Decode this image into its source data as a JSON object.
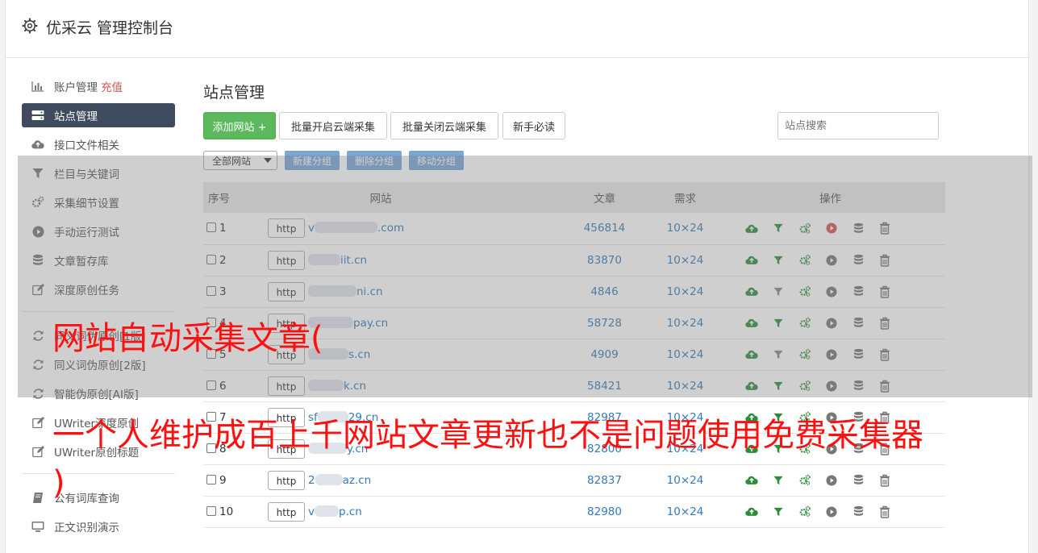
{
  "header": {
    "title": "优采云 管理控制台"
  },
  "sidebar": {
    "items": [
      {
        "label": "账户管理",
        "badge": "充值",
        "icon": "bar-chart-icon"
      },
      {
        "label": "站点管理",
        "icon": "server-icon",
        "active": true
      },
      {
        "label": "接口文件相关",
        "icon": "cloud-upload-icon"
      },
      {
        "label": "栏目与关键词",
        "icon": "filter-icon"
      },
      {
        "label": "采集细节设置",
        "icon": "cogs-icon"
      },
      {
        "label": "手动运行测试",
        "icon": "play-icon"
      },
      {
        "label": "文章暂存库",
        "icon": "database-icon"
      },
      {
        "label": "深度原创任务",
        "icon": "edit-icon"
      }
    ],
    "items2": [
      {
        "label": "同义词伪原创[1版]",
        "icon": "refresh-icon"
      },
      {
        "label": "同义词伪原创[2版]",
        "icon": "refresh-icon"
      },
      {
        "label": "智能伪原创[AI版]",
        "icon": "refresh-icon"
      },
      {
        "label": "UWriter深度原创",
        "icon": "edit-icon"
      },
      {
        "label": "UWriter原创标题",
        "icon": "edit-icon"
      }
    ],
    "items3": [
      {
        "label": "公有词库查询",
        "icon": "book-icon"
      },
      {
        "label": "正文识别演示",
        "icon": "monitor-icon"
      }
    ]
  },
  "main": {
    "title": "站点管理",
    "buttons": {
      "add": "添加网站 +",
      "batch_open": "批量开启云端采集",
      "batch_close": "批量关闭云端采集",
      "guide": "新手必读"
    },
    "search_placeholder": "站点搜索",
    "group_select": "全部网站",
    "group_buttons": {
      "new": "新建分组",
      "delete": "删除分组",
      "move": "移动分组"
    },
    "table": {
      "headers": {
        "index": "序号",
        "site": "网站",
        "articles": "文章",
        "demand": "需求",
        "ops": "操作"
      },
      "rows": [
        {
          "index": "1",
          "proto": "http",
          "prefix": "v",
          "suffix": ".com",
          "articles": "456814",
          "demand": "10×24",
          "filter_active": true,
          "play_active": true
        },
        {
          "index": "2",
          "proto": "http",
          "prefix": "",
          "suffix": "iit.cn",
          "articles": "83870",
          "demand": "10×24",
          "filter_active": true,
          "play_active": false
        },
        {
          "index": "3",
          "proto": "http",
          "prefix": "",
          "suffix": "ni.cn",
          "articles": "4846",
          "demand": "10×24",
          "filter_active": false,
          "play_active": false
        },
        {
          "index": "4",
          "proto": "http",
          "prefix": "",
          "suffix": "pay.cn",
          "articles": "58728",
          "demand": "10×24",
          "filter_active": true,
          "play_active": false
        },
        {
          "index": "5",
          "proto": "http",
          "prefix": "",
          "suffix": "s.cn",
          "articles": "4909",
          "demand": "10×24",
          "filter_active": false,
          "play_active": false
        },
        {
          "index": "6",
          "proto": "http",
          "prefix": "",
          "suffix": "k.cn",
          "articles": "58421",
          "demand": "10×24",
          "filter_active": true,
          "play_active": false
        },
        {
          "index": "7",
          "proto": "http",
          "prefix": "sf",
          "suffix": "29.cn",
          "articles": "82987",
          "demand": "10×24",
          "filter_active": true,
          "play_active": false
        },
        {
          "index": "8",
          "proto": "http",
          "prefix": "",
          "suffix": "y.cn",
          "articles": "82800",
          "demand": "10×24",
          "filter_active": true,
          "play_active": false
        },
        {
          "index": "9",
          "proto": "http",
          "prefix": "2",
          "suffix": "az.cn",
          "articles": "82837",
          "demand": "10×24",
          "filter_active": true,
          "play_active": false
        },
        {
          "index": "10",
          "proto": "http",
          "prefix": "v",
          "suffix": "p.cn",
          "articles": "82980",
          "demand": "10×24",
          "filter_active": true,
          "play_active": false
        }
      ]
    }
  },
  "caption": {
    "line1": "网站自动采集文章(",
    "line2": "一个人维护成百上千网站文章更新也不是问题使用免费采集器",
    "line3": ")"
  },
  "colors": {
    "green": "#5cb85c",
    "sidebar_active": "#3e4a5e",
    "link_blue": "#337ab7",
    "caption_red": "#ff1010",
    "play_red": "#d9534f",
    "group_btn_blue": "#7ba7d7"
  }
}
